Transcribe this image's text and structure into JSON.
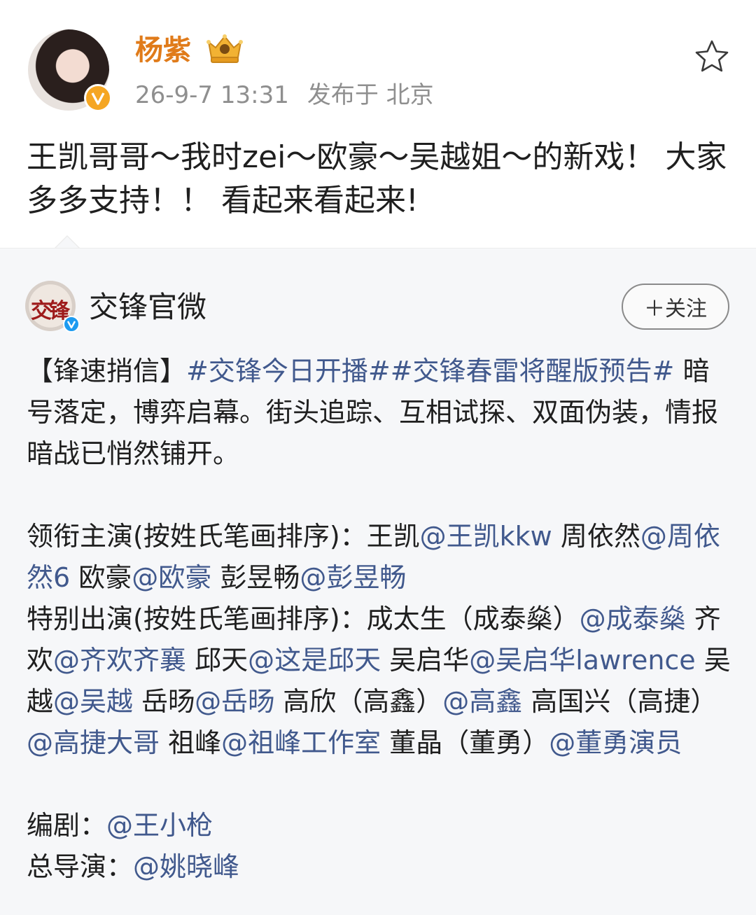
{
  "post": {
    "username": "杨紫",
    "timestamp": "26-9-7 13:31",
    "location": "发布于 北京",
    "text": "王凯哥哥～我时zei～欧豪～吴越姐～的新戏！ 大家多多支持！！ 看起来看起来!"
  },
  "icons": {
    "avatar_badge": "verified-v-icon",
    "crown": "crown-icon",
    "favorite": "star-outline-icon",
    "repost_badge": "verified-v-icon"
  },
  "colors": {
    "username": "#e07b1a",
    "link": "#41598d",
    "meta": "#8f8f8f",
    "repost_bg": "#f6f7f9"
  },
  "repost": {
    "account_name": "交锋官微",
    "avatar_text": "交锋",
    "follow_label": "＋关注",
    "intro_prefix": "【锋速捎信】",
    "hashtag_1": "#交锋今日开播#",
    "hashtag_2": "#交锋春雷将醒版预告#",
    "intro_body": " 暗号落定，博弈启幕。街头追踪、互相试探、双面伪装，情报暗战已悄然铺开。",
    "lead_label": "领衔主演(按姓氏笔画排序)：",
    "leads": [
      {
        "name": "王凯",
        "handle": "@王凯kkw"
      },
      {
        "name": " 周依然",
        "handle": "@周依然6"
      },
      {
        "name": " 欧豪",
        "handle": "@欧豪"
      },
      {
        "name": " 彭昱畅",
        "handle": "@彭昱畅"
      }
    ],
    "special_label": "特别出演(按姓氏笔画排序)：",
    "specials": [
      {
        "name": "成太生（成泰燊）",
        "handle": "@成泰燊"
      },
      {
        "name": " 齐欢",
        "handle": "@齐欢齐襄"
      },
      {
        "name": " 邱天",
        "handle": "@这是邱天"
      },
      {
        "name": " 吴启华",
        "handle": "@吴启华lawrence"
      },
      {
        "name": " 吴越",
        "handle": "@吴越"
      },
      {
        "name": " 岳旸",
        "handle": "@岳旸"
      },
      {
        "name": " 高欣（高鑫）",
        "handle": "@高鑫"
      },
      {
        "name": " 高国兴（高捷）",
        "handle": "@高捷大哥"
      },
      {
        "name": " 祖峰",
        "handle": "@祖峰工作室"
      },
      {
        "name": " 董晶（董勇）",
        "handle": "@董勇演员"
      }
    ],
    "writer_label": "编剧：",
    "writer_handle": "@王小枪",
    "director_label": "总导演：",
    "director_handle": "@姚晓峰"
  }
}
